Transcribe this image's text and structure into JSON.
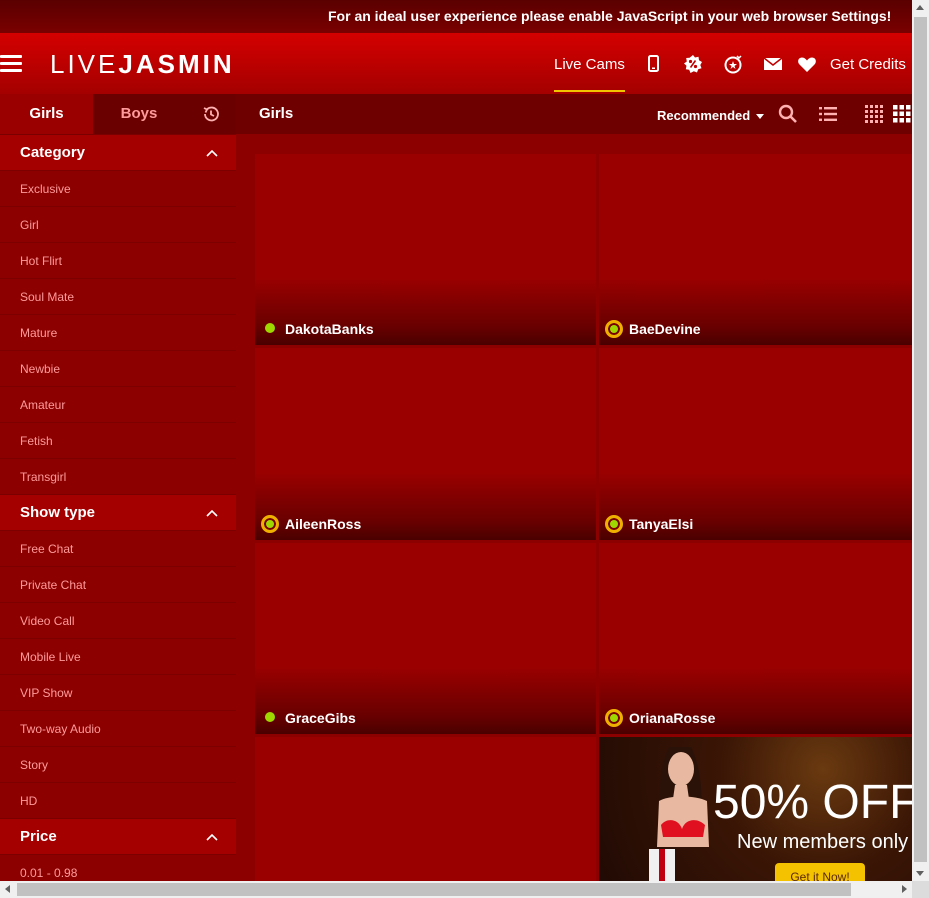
{
  "notice": {
    "text": "For an ideal user experience please enable JavaScript in your web browser Settings!"
  },
  "header": {
    "logo_part1": "LIVE",
    "logo_part2": "JASMIN",
    "nav_live": "Live Cams",
    "get_credits": "Get Credits",
    "icons": [
      "menu-icon",
      "mobile-icon",
      "promo-icon",
      "bonus-icon",
      "mail-icon",
      "heart-icon"
    ],
    "accent": "#f0c400"
  },
  "sidebar": {
    "tabs": {
      "girls": "Girls",
      "boys": "Boys",
      "history_icon": "history-icon"
    },
    "category": {
      "title": "Category",
      "items": [
        "Exclusive",
        "Girl",
        "Hot Flirt",
        "Soul Mate",
        "Mature",
        "Newbie",
        "Amateur",
        "Fetish",
        "Transgirl"
      ]
    },
    "show_type": {
      "title": "Show type",
      "items": [
        "Free Chat",
        "Private Chat",
        "Video Call",
        "Mobile Live",
        "VIP Show",
        "Two-way Audio",
        "Story",
        "HD"
      ]
    },
    "price": {
      "title": "Price",
      "items": [
        "0.01 - 0.98"
      ]
    }
  },
  "content": {
    "title": "Girls",
    "sort_label": "Recommended",
    "icons": [
      "search-icon",
      "list-view-icon",
      "small-grid-icon",
      "large-grid-icon"
    ],
    "performers": [
      {
        "name": "DakotaBanks",
        "status": "online"
      },
      {
        "name": "BaeDevine",
        "status": "vip"
      },
      {
        "name": "AileenRoss",
        "status": "vip"
      },
      {
        "name": "TanyaElsi",
        "status": "vip"
      },
      {
        "name": "GraceGibs",
        "status": "online"
      },
      {
        "name": "OrianaRosse",
        "status": "vip"
      }
    ],
    "promo": {
      "percent": "50% OFF",
      "subtitle": "New members only",
      "button": "Get it Now!"
    }
  },
  "colors": {
    "online_dot": "#9fd800",
    "vip_ring": "#f0b000",
    "header_red": "#d40000"
  }
}
